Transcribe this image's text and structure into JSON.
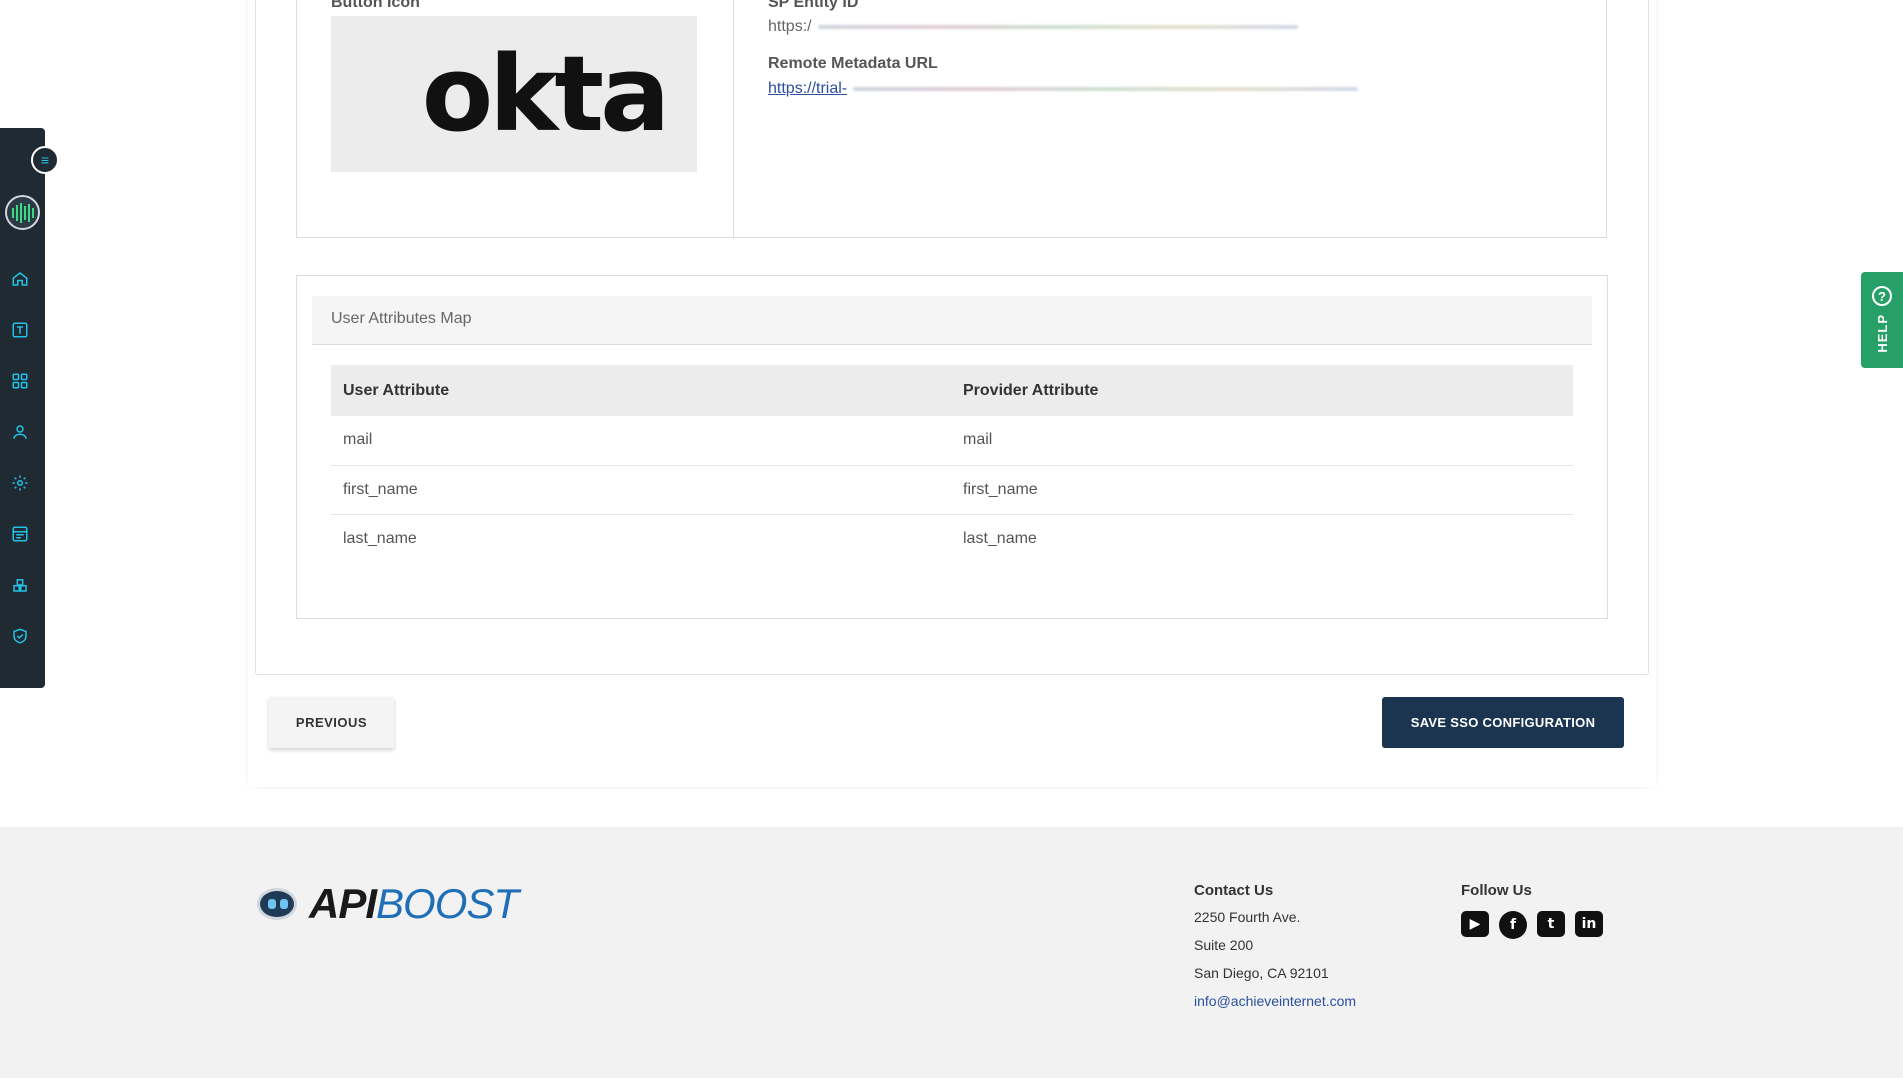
{
  "form": {
    "button_icon_label": "Button Icon",
    "okta_logo_text": "okta",
    "sp_entity_id_label": "SP Entity ID",
    "sp_entity_id_value": "https:/",
    "remote_metadata_label": "Remote Metadata URL",
    "remote_metadata_value": "https://trial-"
  },
  "attributes": {
    "section_title": "User Attributes Map",
    "columns": [
      "User Attribute",
      "Provider Attribute"
    ],
    "rows": [
      [
        "mail",
        "mail"
      ],
      [
        "first_name",
        "first_name"
      ],
      [
        "last_name",
        "last_name"
      ]
    ]
  },
  "actions": {
    "previous_label": "PREVIOUS",
    "save_label": "SAVE SSO CONFIGURATION"
  },
  "help": {
    "label": "HELP"
  },
  "sidebar": {
    "items": [
      "home-icon",
      "text-icon",
      "grid-icon",
      "user-icon",
      "gear-icon",
      "list-icon",
      "boxes-icon",
      "shield-icon"
    ]
  },
  "footer": {
    "logo_api": "API",
    "logo_boost": "BOOST",
    "contact_title": "Contact Us",
    "address_line1": "2250 Fourth Ave.",
    "address_line2": "Suite 200",
    "address_line3": "San Diego, CA 92101",
    "email": "info@achieveinternet.com",
    "follow_title": "Follow Us",
    "social": [
      "youtube-icon",
      "facebook-icon",
      "twitter-icon",
      "linkedin-icon"
    ]
  },
  "colors": {
    "sidebar_bg": "#1f2a33",
    "accent": "#22c3e6",
    "primary_button": "#1b3550",
    "help_tab": "#27a067",
    "footer_bg": "#f2f2f2"
  }
}
